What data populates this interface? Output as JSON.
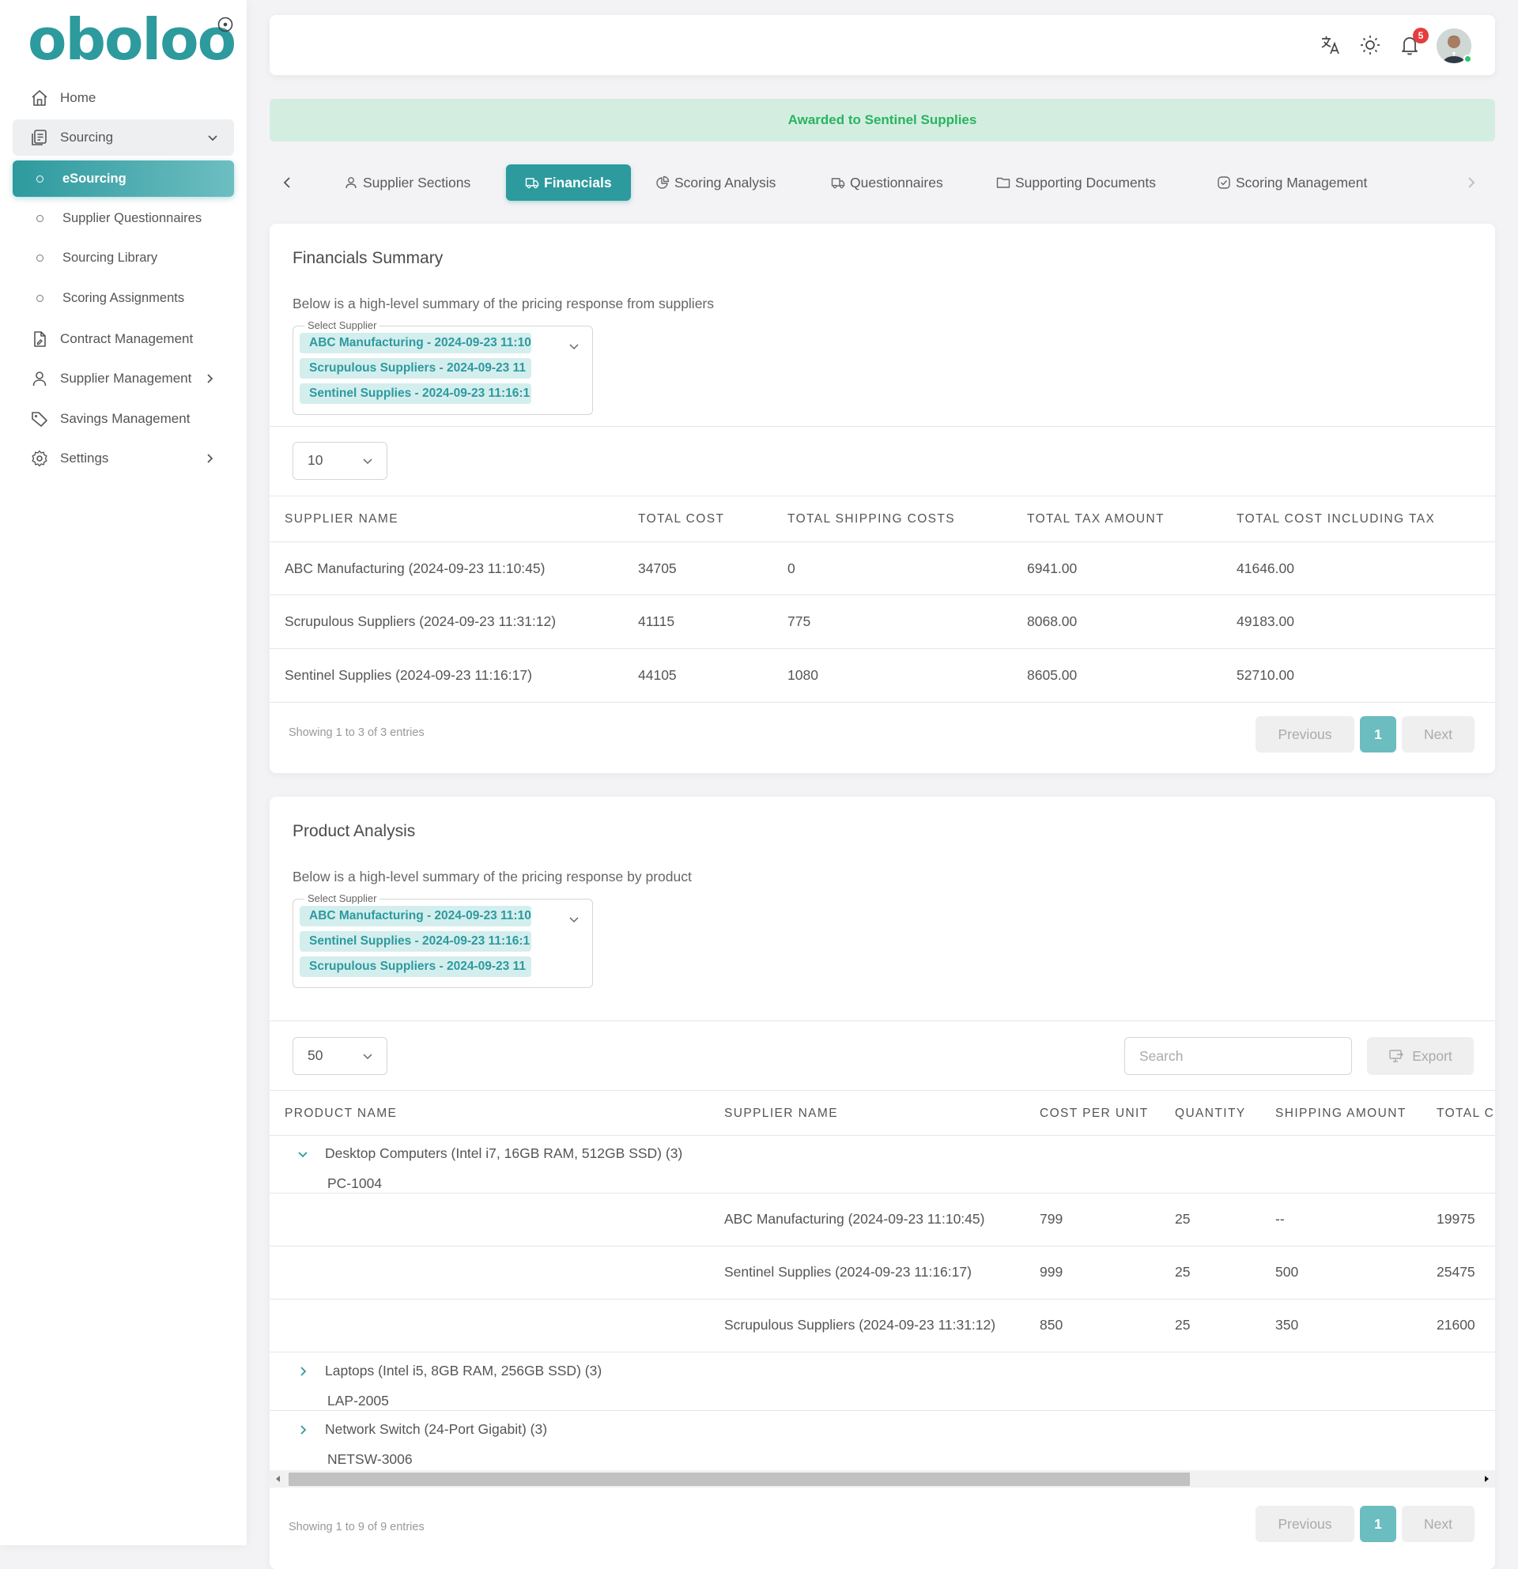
{
  "app": {
    "logo": "oboloo",
    "brand_color": "#2d9a9e"
  },
  "sidebar": {
    "items": [
      {
        "label": "Home",
        "icon": "home-icon"
      },
      {
        "label": "Sourcing",
        "icon": "document-list-icon",
        "expanded": true,
        "children": [
          {
            "label": "eSourcing",
            "active": true
          },
          {
            "label": "Supplier Questionnaires"
          },
          {
            "label": "Sourcing Library"
          },
          {
            "label": "Scoring Assignments"
          }
        ]
      },
      {
        "label": "Contract Management",
        "icon": "contract-icon"
      },
      {
        "label": "Supplier Management",
        "icon": "user-icon"
      },
      {
        "label": "Savings Management",
        "icon": "tag-icon"
      },
      {
        "label": "Settings",
        "icon": "gear-icon"
      }
    ]
  },
  "topbar": {
    "notification_count": "5",
    "icons": [
      "translate-icon",
      "sun-icon",
      "bell-icon"
    ]
  },
  "banner": {
    "text": "Awarded to Sentinel Supplies",
    "color": "#28b45f"
  },
  "tabs": [
    {
      "label": "Supplier Sections",
      "icon": "user-icon"
    },
    {
      "label": "Financials",
      "icon": "truck-icon",
      "active": true
    },
    {
      "label": "Scoring Analysis",
      "icon": "pie-chart-icon"
    },
    {
      "label": "Questionnaires",
      "icon": "truck-icon"
    },
    {
      "label": "Supporting Documents",
      "icon": "folder-icon"
    },
    {
      "label": "Scoring Management",
      "icon": "check-circle-icon"
    }
  ],
  "financials": {
    "title": "Financials Summary",
    "description": "Below is a high-level summary of the pricing response from suppliers",
    "select_label": "Select Supplier",
    "selected": [
      "ABC Manufacturing - 2024-09-23 11:10",
      "Scrupulous Suppliers - 2024-09-23 11",
      "Sentinel Supplies - 2024-09-23 11:16:1"
    ],
    "page_length": "10",
    "columns": [
      "SUPPLIER NAME",
      "TOTAL COST",
      "TOTAL SHIPPING COSTS",
      "TOTAL TAX AMOUNT",
      "TOTAL COST INCLUDING TAX"
    ],
    "rows": [
      [
        "ABC Manufacturing (2024-09-23 11:10:45)",
        "34705",
        "0",
        "6941.00",
        "41646.00"
      ],
      [
        "Scrupulous Suppliers (2024-09-23 11:31:12)",
        "41115",
        "775",
        "8068.00",
        "49183.00"
      ],
      [
        "Sentinel Supplies (2024-09-23 11:16:17)",
        "44105",
        "1080",
        "8605.00",
        "52710.00"
      ]
    ],
    "showing": "Showing 1 to 3 of 3 entries",
    "pager": {
      "previous": "Previous",
      "page": "1",
      "next": "Next"
    }
  },
  "products": {
    "title": "Product Analysis",
    "description": "Below is a high-level summary of the pricing response by product",
    "select_label": "Select Supplier",
    "selected": [
      "ABC Manufacturing - 2024-09-23 11:10",
      "Sentinel Supplies - 2024-09-23 11:16:1",
      "Scrupulous Suppliers - 2024-09-23 11"
    ],
    "page_length": "50",
    "search_placeholder": "Search",
    "export_label": "Export",
    "columns": [
      "PRODUCT NAME",
      "SUPPLIER NAME",
      "COST PER UNIT",
      "QUANTITY",
      "SHIPPING AMOUNT",
      "TOTAL CO"
    ],
    "groups": [
      {
        "name": "Desktop Computers (Intel i7, 16GB RAM, 512GB SSD) (3)",
        "code": "PC-1004",
        "expanded": true,
        "rows": [
          [
            "ABC Manufacturing (2024-09-23 11:10:45)",
            "799",
            "25",
            "--",
            "19975"
          ],
          [
            "Sentinel Supplies (2024-09-23 11:16:17)",
            "999",
            "25",
            "500",
            "25475"
          ],
          [
            "Scrupulous Suppliers (2024-09-23 11:31:12)",
            "850",
            "25",
            "350",
            "21600"
          ]
        ]
      },
      {
        "name": "Laptops (Intel i5, 8GB RAM, 256GB SSD) (3)",
        "code": "LAP-2005",
        "expanded": false
      },
      {
        "name": "Network Switch (24-Port Gigabit) (3)",
        "code": "NETSW-3006",
        "expanded": false
      }
    ],
    "showing": "Showing 1 to 9 of 9 entries",
    "pager": {
      "previous": "Previous",
      "page": "1",
      "next": "Next"
    }
  }
}
